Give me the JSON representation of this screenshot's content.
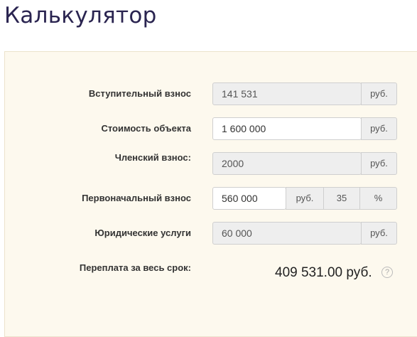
{
  "page": {
    "title": "Калькулятор"
  },
  "rows": [
    {
      "label": "Вступительный взнос",
      "value": "141 531",
      "unit": "руб."
    },
    {
      "label": "Стоимость объекта",
      "value": "1 600 000",
      "unit": "руб."
    },
    {
      "label": "Членский взнос:",
      "value": "2000",
      "unit": "руб."
    },
    {
      "label": "Первоначальный взнос",
      "value": "560 000",
      "unit": "руб.",
      "percent_value": "35",
      "percent_unit": "%"
    },
    {
      "label": "Юридические услуги",
      "value": "60 000",
      "unit": "руб."
    }
  ],
  "result": {
    "label": "Переплата за весь срок:",
    "value": "409 531.00 руб.",
    "help_icon": "?"
  }
}
